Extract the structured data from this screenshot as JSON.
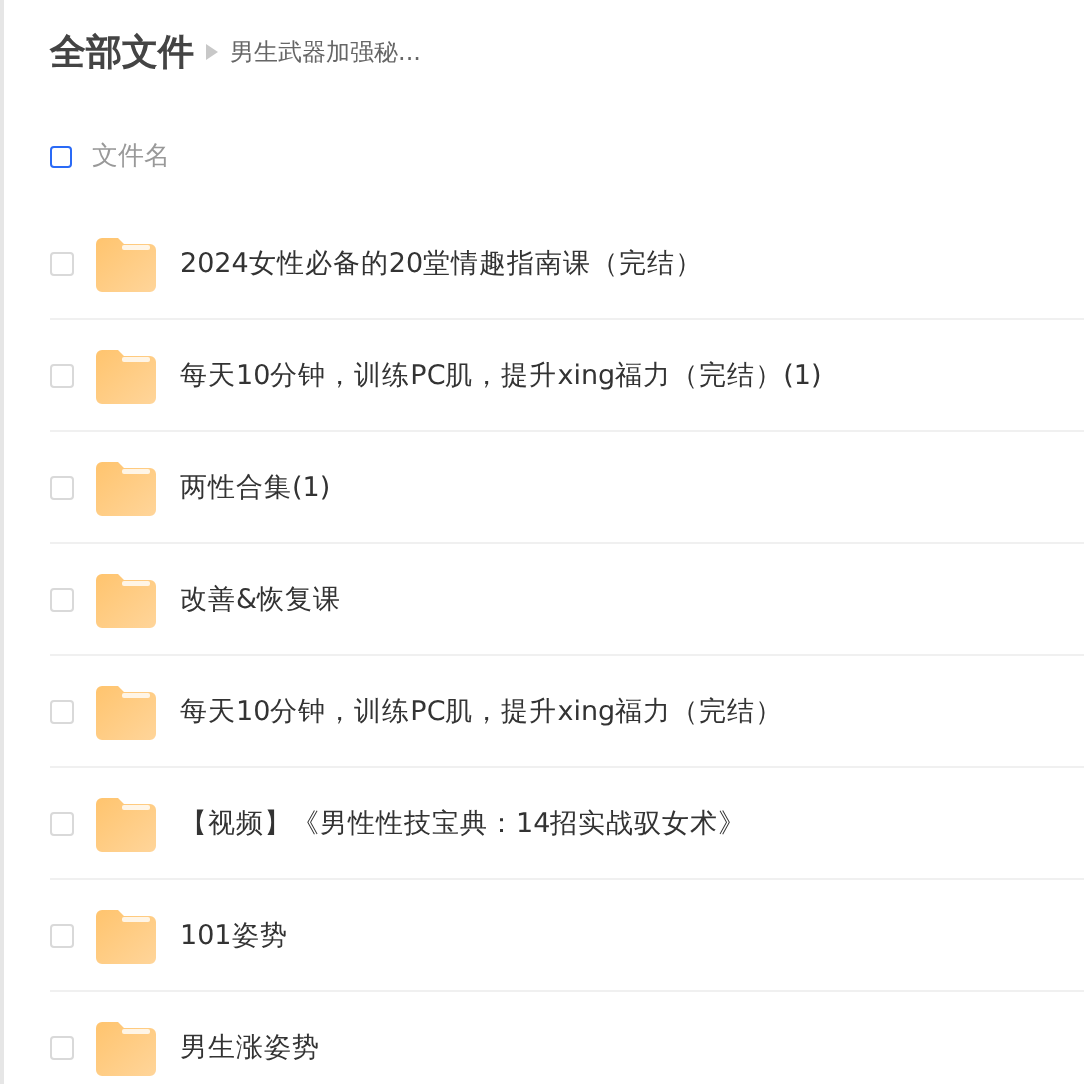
{
  "breadcrumb": {
    "root": "全部文件",
    "current": "男生武器加强秘..."
  },
  "list_header": {
    "label": "文件名",
    "checked": false
  },
  "files": [
    {
      "name": "2024女性必备的20堂情趣指南课（完结）",
      "selected": false
    },
    {
      "name": "每天10分钟，训练PC肌，提升xing福力（完结）(1)",
      "selected": false
    },
    {
      "name": "两性合集(1)",
      "selected": false
    },
    {
      "name": "改善&恢复课",
      "selected": false
    },
    {
      "name": "每天10分钟，训练PC肌，提升xing福力（完结）",
      "selected": false
    },
    {
      "name": "【视频】《男性性技宝典：14招实战驭女术》",
      "selected": false
    },
    {
      "name": "101姿势",
      "selected": false
    },
    {
      "name": "男生涨姿势",
      "selected": false
    }
  ]
}
